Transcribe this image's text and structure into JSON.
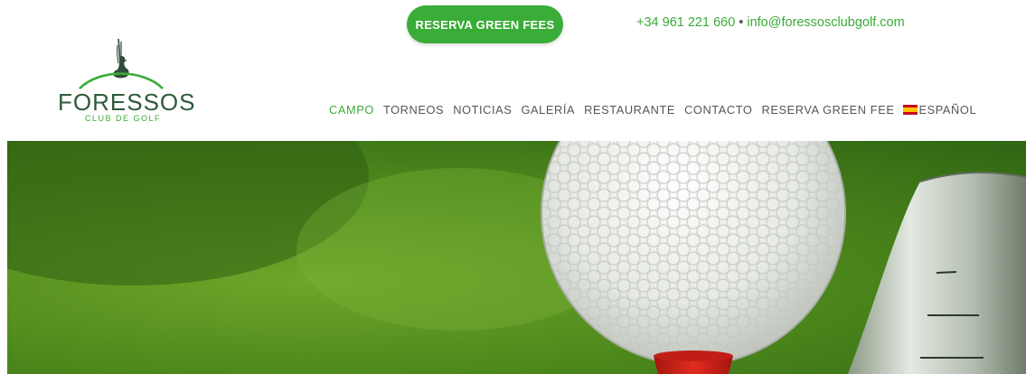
{
  "header": {
    "cta_label": "RESERVA GREEN FEES",
    "phone": "+34 961 221 660",
    "separator": "•",
    "email": "info@foressosclubgolf.com"
  },
  "logo": {
    "name": "FORESSOS",
    "subtitle": "CLUB DE GOLF",
    "icon": "duck-reed-icon"
  },
  "nav": {
    "items": [
      {
        "label": "CAMPO",
        "active": true
      },
      {
        "label": "TORNEOS",
        "active": false
      },
      {
        "label": "NOTICIAS",
        "active": false
      },
      {
        "label": "GALERÍA",
        "active": false
      },
      {
        "label": "RESTAURANTE",
        "active": false
      },
      {
        "label": "CONTACTO",
        "active": false
      },
      {
        "label": "RESERVA GREEN FEE",
        "active": false
      }
    ],
    "language": "ESPAÑOL",
    "language_icon": "spain-flag-icon"
  },
  "hero": {
    "image": "golf-ball-on-red-tee-with-club",
    "colors": {
      "grass": "#4f8a1c",
      "tee": "#d8261c",
      "accent": "#3aac38"
    }
  }
}
